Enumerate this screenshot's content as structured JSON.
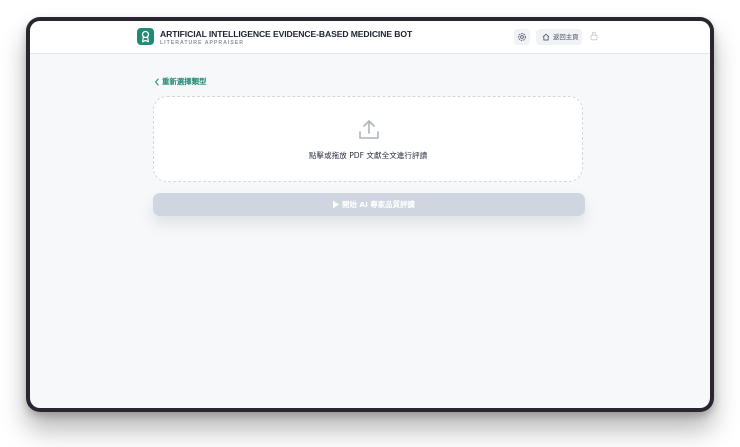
{
  "header": {
    "title": "ARTIFICIAL INTELLIGENCE EVIDENCE-BASED MEDICINE BOT",
    "subtitle": "LITERATURE APPRAISER",
    "home_label": "返回主頁",
    "settings_icon": "gear-icon",
    "home_icon": "home-icon",
    "lock_icon": "lock-icon",
    "logo_icon": "award-icon"
  },
  "main": {
    "back_label": "重新選擇類型",
    "upload": {
      "icon": "upload-icon",
      "label": "點擊或拖放 PDF 文獻全文進行評讀"
    },
    "start_button": {
      "icon": "play-icon",
      "label": "開始 AI 專家品質評讀",
      "enabled": false
    }
  },
  "colors": {
    "accent": "#1f8a76",
    "button_disabled": "#cfd6e0",
    "background": "#f7f8fa",
    "frame": "#2a2530"
  }
}
